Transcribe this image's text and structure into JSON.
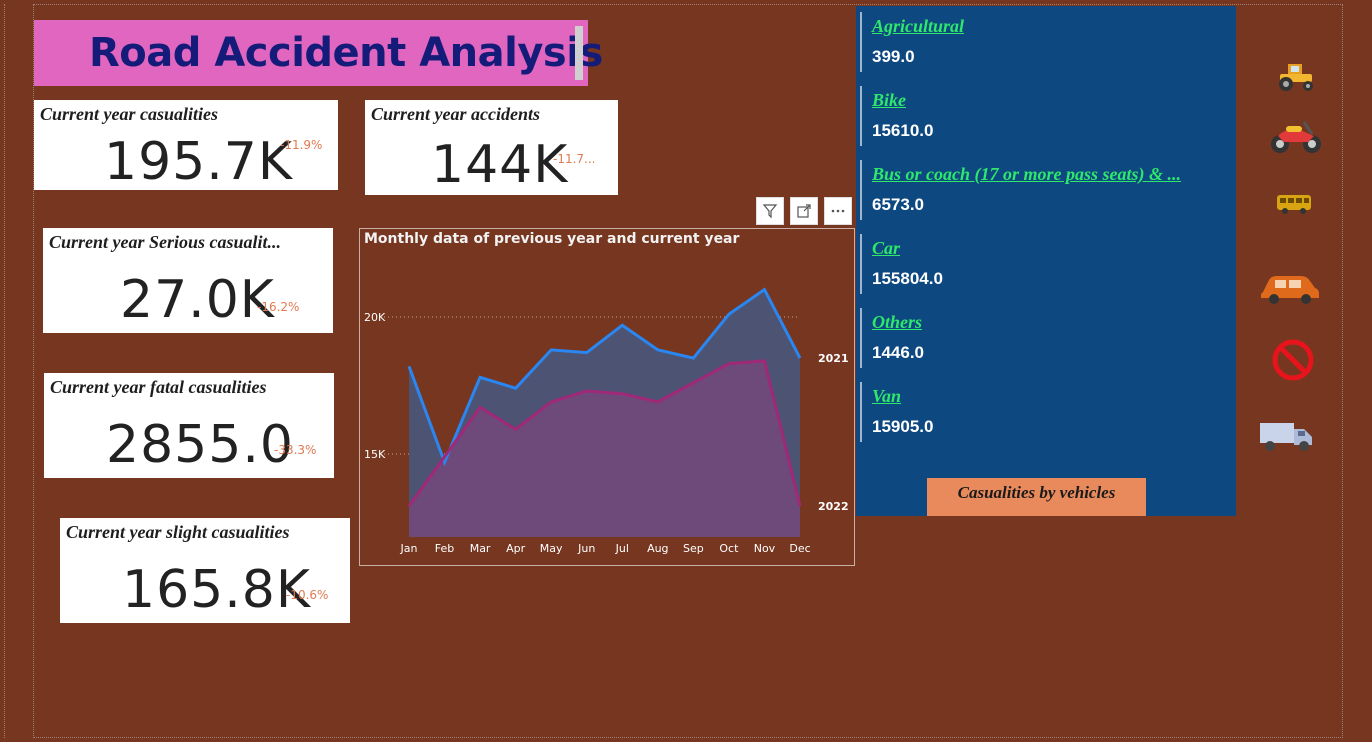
{
  "header": {
    "title": "Road Accident Analysis"
  },
  "kpis": {
    "casualties": {
      "label": "Current year casualities",
      "value": "195.7K",
      "delta": "-11.9%"
    },
    "accidents": {
      "label": "Current year accidents",
      "value": "144K",
      "delta": "-11.7..."
    },
    "serious": {
      "label": "Current year Serious casualit...",
      "value": "27.0K",
      "delta": "-16.2%"
    },
    "fatal": {
      "label": "Current year fatal casualities",
      "value": "2855.0",
      "delta": "-33.3%"
    },
    "slight": {
      "label": "Current year slight casualities",
      "value": "165.8K",
      "delta": "-10.6%"
    }
  },
  "chart_tools": {
    "filter": "filter-icon",
    "focus": "focus-mode-icon",
    "more": "more-options-icon"
  },
  "chart_data": {
    "type": "area",
    "title": "Monthly data of previous year and current year",
    "categories": [
      "Jan",
      "Feb",
      "Mar",
      "Apr",
      "May",
      "Jun",
      "Jul",
      "Aug",
      "Sep",
      "Oct",
      "Nov",
      "Dec"
    ],
    "yticks": [
      "20K",
      "15K"
    ],
    "ytick_values": [
      20000,
      15000
    ],
    "ylim": [
      12000,
      22000
    ],
    "grid": true,
    "series": [
      {
        "name": "2021",
        "color": "#2a86f0",
        "fill": "#4a5578",
        "values": [
          18200,
          14700,
          17800,
          17400,
          18800,
          18700,
          19700,
          18800,
          18500,
          20100,
          21000,
          18500
        ]
      },
      {
        "name": "2022",
        "color": "#a02878",
        "fill": "#6f4a7a",
        "values": [
          13100,
          14900,
          16700,
          15900,
          16900,
          17300,
          17200,
          16900,
          17600,
          18300,
          18400,
          13100
        ]
      }
    ]
  },
  "vehicles": {
    "caption": "Casualities by vehicles",
    "items": [
      {
        "name": "Agricultural",
        "count": "399.0",
        "icon": "tractor-icon"
      },
      {
        "name": "Bike",
        "count": "15610.0",
        "icon": "motorbike-icon"
      },
      {
        "name": "Bus or coach (17 or more pass seats) & ...",
        "count": "6573.0",
        "icon": "bus-icon"
      },
      {
        "name": "Car",
        "count": "155804.0",
        "icon": "car-icon"
      },
      {
        "name": "Others",
        "count": "1446.0",
        "icon": "prohibited-icon"
      },
      {
        "name": "Van",
        "count": "15905.0",
        "icon": "truck-icon"
      }
    ]
  },
  "colors": {
    "background": "#76361f",
    "title_bg": "#e066c0",
    "title_text": "#141b78",
    "panel_bg": "#0d4880",
    "vehicle_name": "#2ee86b",
    "delta": "#e07a52",
    "caption_bg": "#e88a5c"
  }
}
